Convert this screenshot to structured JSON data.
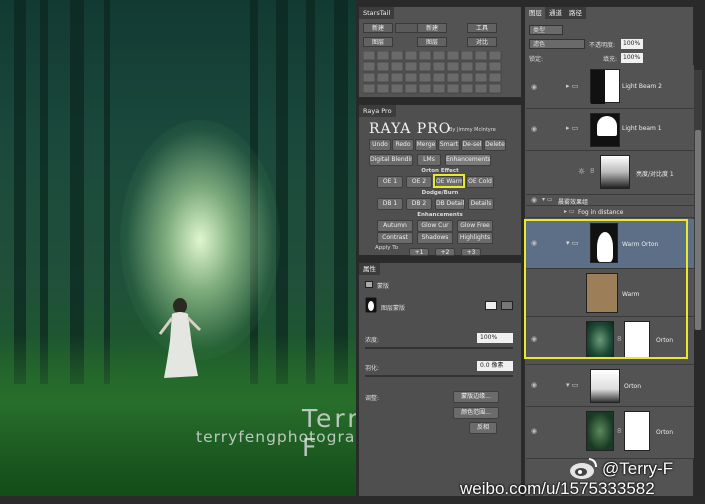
{
  "photo": {
    "watermark_name": "Terry F",
    "watermark_url": "terryfengphotography.lofter.com"
  },
  "starstail": {
    "title": "StarsTail",
    "buttons": [
      "新建",
      "新建",
      "工具",
      "图层",
      "图层",
      "对比"
    ]
  },
  "raya": {
    "tab": "Raya Pro",
    "title": "RAYA PRO",
    "by": "By Jimmy McIntyre",
    "top_buttons": [
      "Undo",
      "Redo",
      "Merge",
      "Smart",
      "De-sel",
      "Delete"
    ],
    "tabs": [
      "Digital Blending",
      "LMs",
      "Enhancements"
    ],
    "orton_title": "Orton Effect",
    "orton_buttons": [
      "OE 1",
      "OE 2",
      "OE Warm",
      "OE Cold"
    ],
    "dodge_title": "Dodge/Burn",
    "dodge_buttons": [
      "DB 1",
      "DB 2",
      "DB Details",
      "Details"
    ],
    "enh_title": "Enhancements",
    "enh_row1": [
      "Autumn",
      "Glow Cur",
      "Glow Free"
    ],
    "enh_row2": [
      "Contrast",
      "Shadows",
      "Highlights"
    ],
    "apply_label": "Apply To",
    "apply_buttons": [
      "+1",
      "+2",
      "+3"
    ]
  },
  "properties": {
    "tab": "属性",
    "header": "蒙版",
    "mask_label": "图层蒙版",
    "density_label": "浓度:",
    "density_value": "100%",
    "feather_label": "羽化:",
    "feather_value": "0.0 像素",
    "adjust_label": "调整:",
    "btn_edge": "蒙版边缘...",
    "btn_color_range": "颜色范围...",
    "btn_invert": "反相"
  },
  "layers": {
    "tabs": [
      "图层",
      "通道",
      "路径"
    ],
    "kind_label": "类型",
    "blend_mode": "滤色",
    "opacity_label": "不透明度:",
    "opacity_value": "100%",
    "lock_label": "锁定:",
    "fill_label": "填充:",
    "fill_value": "100%",
    "items": [
      {
        "name": "Light Beam 2"
      },
      {
        "name": "Light beam 1"
      },
      {
        "name": "亮度/对比度 1"
      },
      {
        "name": "晨雾效果组"
      },
      {
        "name": "Fog in distance"
      },
      {
        "name": "Warm Orton"
      },
      {
        "name": "Warm"
      },
      {
        "name": "Orton"
      },
      {
        "name": "Orton"
      },
      {
        "name": "Orton"
      }
    ]
  },
  "weibo": {
    "handle": "@Terry-F",
    "url": "weibo.com/u/1575333582"
  },
  "colors": {
    "highlight": "#e8e82c",
    "selected_layer": "#5d6e87",
    "warm_fill": "#9c7f58"
  }
}
